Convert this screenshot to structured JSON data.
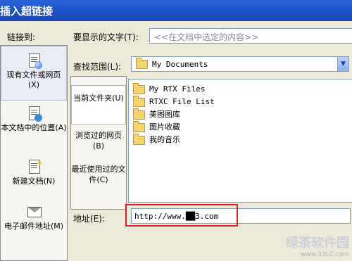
{
  "window": {
    "title": "插入超链接"
  },
  "link_to": {
    "label": "链接到:",
    "items": [
      {
        "label": "现有文件或网页(X)",
        "selected": true,
        "icon": "page-globe-icon"
      },
      {
        "label": "本文档中的位置(A)",
        "selected": false,
        "icon": "page-anchor-icon"
      },
      {
        "label": "新建文档(N)",
        "selected": false,
        "icon": "new-doc-icon"
      },
      {
        "label": "电子邮件地址(M)",
        "selected": false,
        "icon": "email-icon"
      }
    ]
  },
  "display_text": {
    "label": "要显示的文字(T):",
    "value": "<<在文档中选定的内容>>"
  },
  "look_in": {
    "label": "查找范围(L):",
    "value": "My Documents"
  },
  "scope": {
    "items": [
      {
        "label": "当前文件夹(U)",
        "selected": true
      },
      {
        "label": "浏览过的网页(B)",
        "selected": false
      },
      {
        "label": "最近使用过的文件(C)",
        "selected": false
      }
    ]
  },
  "files": [
    {
      "name": "My RTX Files"
    },
    {
      "name": "RTXC File List"
    },
    {
      "name": "美图图库"
    },
    {
      "name": "图片收藏"
    },
    {
      "name": "我的音乐"
    }
  ],
  "address": {
    "label": "地址(E):",
    "value": "http://www.██3.com"
  },
  "colors": {
    "highlight": "#d8232a",
    "title_bar": "#1b4fc4"
  },
  "watermark": {
    "text": "绿茶软件园",
    "url": "www.33LC.com"
  }
}
